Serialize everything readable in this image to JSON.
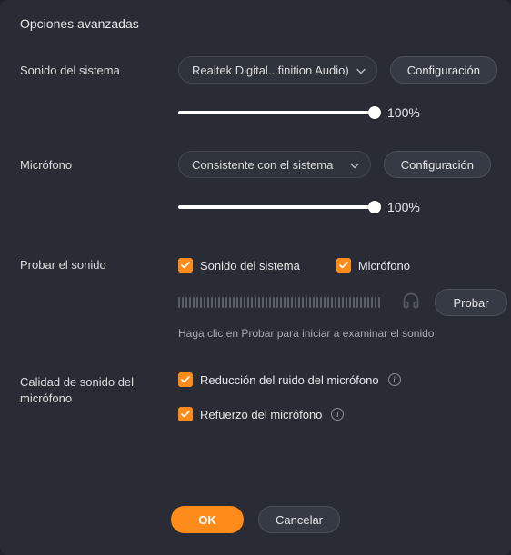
{
  "title": "Opciones avanzadas",
  "systemSound": {
    "label": "Sonido del sistema",
    "device": "Realtek Digital...finition Audio)",
    "configBtn": "Configuración",
    "volume": "100%",
    "sliderPos": 100
  },
  "microphone": {
    "label": "Micrófono",
    "device": "Consistente con el sistema",
    "configBtn": "Configuración",
    "volume": "100%",
    "sliderPos": 100
  },
  "testSound": {
    "label": "Probar el sonido",
    "systemCheckbox": "Sonido del sistema",
    "micCheckbox": "Micrófono",
    "testBtn": "Probar",
    "hint": "Haga clic en Probar para iniciar a examinar el sonido"
  },
  "micQuality": {
    "label": "Calidad de sonido del micrófono",
    "noiseReduction": "Reducción del ruido del micrófono",
    "boost": "Refuerzo del micrófono"
  },
  "footer": {
    "ok": "OK",
    "cancel": "Cancelar"
  }
}
